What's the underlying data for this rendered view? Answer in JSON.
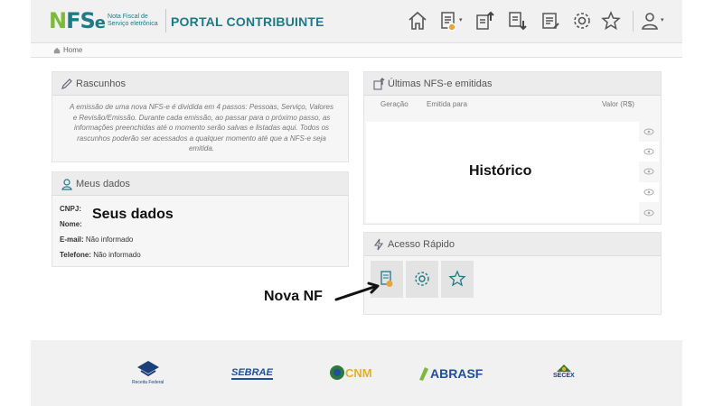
{
  "header": {
    "logo_text": "NFSe",
    "logo_caption": "Nota Fiscal de Serviço eletrônica",
    "portal_title": "PORTAL CONTRIBUINTE",
    "icons": [
      "home-icon",
      "new-invoice-icon",
      "upload-icon",
      "download-icon",
      "list-icon",
      "gear-icon",
      "star-icon",
      "user-icon"
    ]
  },
  "breadcrumb": {
    "home": "Home"
  },
  "rascunhos": {
    "title": "Rascunhos",
    "text": "A emissão de uma nova NFS-e é dividida em 4 passos: Pessoas, Serviço, Valores e Revisão/Emissão. Durante cada emissão, ao passar para o próximo passo, as informações preenchidas até o momento serão salvas e listadas aqui. Todos os rascunhos poderão ser acessados a qualquer momento até que a NFS-e seja emitida."
  },
  "meus_dados": {
    "title": "Meus dados",
    "cnpj_label": "CNPJ:",
    "nome_label": "Nome:",
    "email_label": "E-mail:",
    "email_value": "Não informado",
    "telefone_label": "Telefone:",
    "telefone_value": "Não informado"
  },
  "ultimas": {
    "title": "Últimas NFS-e emitidas",
    "col_geracao": "Geração",
    "col_emitida": "Emitida para",
    "col_valor": "Valor (R$)"
  },
  "acesso_rapido": {
    "title": "Acesso Rápido"
  },
  "annotations": {
    "seus_dados": "Seus dados",
    "historico": "Histórico",
    "nova_nf": "Nova NF"
  },
  "footer": {
    "logos": [
      {
        "name": "receita-federal-logo",
        "text": "Receita Federal"
      },
      {
        "name": "sebrae-logo",
        "text": "SEBRAE"
      },
      {
        "name": "cnm-logo",
        "text": "CNM"
      },
      {
        "name": "abrasf-logo",
        "text": "ABRASF"
      },
      {
        "name": "secex-logo",
        "text": "SECEX"
      }
    ]
  },
  "colors": {
    "primary": "#1e7a87",
    "accent": "#7dba3c",
    "orange": "#e8a33d"
  }
}
